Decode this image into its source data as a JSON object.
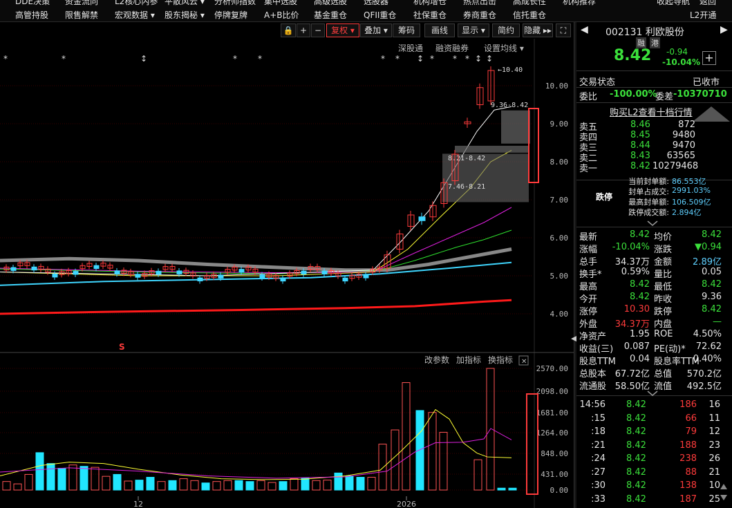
{
  "menu": {
    "row1": [
      {
        "label": "DDE决策",
        "x": 22
      },
      {
        "label": "资金流向",
        "x": 94
      },
      {
        "label": "L2核心内参",
        "x": 166
      },
      {
        "label": "平散风云 ▾",
        "x": 238
      },
      {
        "label": "分析师指数",
        "x": 310
      },
      {
        "label": "集中选股",
        "x": 382
      },
      {
        "label": "高级选股",
        "x": 454
      },
      {
        "label": "选股器",
        "x": 526
      },
      {
        "label": "机构增仓",
        "x": 598
      },
      {
        "label": "热点出击",
        "x": 670
      },
      {
        "label": "高成长性",
        "x": 742
      },
      {
        "label": "机构推荐",
        "x": 814
      }
    ],
    "row1_right": [
      "收起导航",
      "返回"
    ],
    "row2": [
      {
        "label": "高管持股"
      },
      {
        "label": "限售解禁"
      },
      {
        "label": "宏观数据 ▾"
      },
      {
        "label": "股东揭秘 ▾"
      },
      {
        "label": "停牌复牌"
      },
      {
        "label": "A+B比价"
      },
      {
        "label": "基金重仓"
      },
      {
        "label": "QFII重仓"
      },
      {
        "label": "社保重仓"
      },
      {
        "label": "券商重仓"
      },
      {
        "label": "信托重仓"
      }
    ],
    "row2_right": "L2开通"
  },
  "toolbar": {
    "lock": "🔒",
    "plus": "+",
    "minus": "−",
    "fuquan": "复权 ▾",
    "diejia": "叠加 ▾",
    "chouma": "筹码",
    "huaxian": "画线",
    "xianshi": "显示 ▾",
    "jianyue": "简约",
    "yincang": "隐藏 ▸▸",
    "fullscreen": "⛶"
  },
  "subbar": {
    "shengutong": "深股通",
    "rongzi": "融资融券",
    "junxian": "设置均线 ▾"
  },
  "vol_bar": {
    "gaicanshu": "改参数",
    "jiazhibiao": "加指标",
    "huanzhibiao": "换指标",
    "close": "✕"
  },
  "chart_data": [
    {
      "type": "candlestick",
      "title": "",
      "ylim": [
        3.5,
        10.6
      ],
      "yticks": [
        "10.00",
        "9.00",
        "8.00",
        "7.00",
        "6.00",
        "5.00",
        "4.00"
      ],
      "annotations": [
        "10.40",
        "9.36-8.42",
        "8.21-8.42",
        "7.46-8.21"
      ],
      "markers": [
        "*",
        "*",
        "↕",
        "*",
        "*",
        "*",
        "*",
        "↕",
        "*",
        "*",
        "*",
        "↕",
        "↕"
      ],
      "symbol": "S"
    },
    {
      "type": "bar",
      "title": "",
      "ylim": [
        0,
        2700
      ],
      "yticks": [
        "2570.00",
        "2098.00",
        "1681.00",
        "1264.00",
        "848.00",
        "431.00",
        "0.00"
      ],
      "xticks": [
        "12",
        "2026"
      ]
    }
  ],
  "stock": {
    "code_name": "002131 利欧股份",
    "tag1": "融",
    "tag2": "港",
    "price": "8.42",
    "change": "-0.94",
    "pct": "-10.04%",
    "status_label": "交易状态",
    "status_val": "已收市",
    "weibi_label": "委比",
    "weibi_val": "-100.00%",
    "weicha_label": "委差",
    "weicha_val": "-10370710",
    "l2_link": "购买L2查看十档行情",
    "sells": [
      {
        "label": "卖五",
        "price": "8.46",
        "vol": "872"
      },
      {
        "label": "卖四",
        "price": "8.45",
        "vol": "9480"
      },
      {
        "label": "卖三",
        "price": "8.44",
        "vol": "9470"
      },
      {
        "label": "卖二",
        "price": "8.43",
        "vol": "63565"
      },
      {
        "label": "卖一",
        "price": "8.42",
        "vol": "10279468"
      }
    ],
    "limit": {
      "tag": "跌停",
      "rows": [
        {
          "label": "当前封单额:",
          "val": "86.553亿"
        },
        {
          "label": "封单占成交:",
          "val": "2991.03%"
        },
        {
          "label": "最高封单额:",
          "val": "106.509亿"
        },
        {
          "label": "跌停成交额:",
          "val": "2.894亿"
        }
      ]
    },
    "quote": [
      {
        "l1": "最新",
        "v1": "8.42",
        "c1": "green",
        "l2": "均价",
        "v2": "8.42",
        "c2": "green"
      },
      {
        "l1": "涨幅",
        "v1": "-10.04%",
        "c1": "green",
        "l2": "涨跌",
        "v2": "▼0.94",
        "c2": "green"
      },
      {
        "l1": "总手",
        "v1": "34.37万",
        "c1": "white",
        "l2": "金额",
        "v2": "2.89亿",
        "c2": "cyan"
      },
      {
        "l1": "换手*",
        "v1": "0.59%",
        "c1": "white",
        "l2": "量比",
        "v2": "0.05",
        "c2": "white"
      },
      {
        "l1": "最高",
        "v1": "8.42",
        "c1": "green",
        "l2": "最低",
        "v2": "8.42",
        "c2": "green"
      },
      {
        "l1": "今开",
        "v1": "8.42",
        "c1": "green",
        "l2": "昨收",
        "v2": "9.36",
        "c2": "white"
      },
      {
        "l1": "涨停",
        "v1": "10.30",
        "c1": "red",
        "l2": "跌停",
        "v2": "8.42",
        "c2": "green"
      },
      {
        "l1": "外盘",
        "v1": "34.37万",
        "c1": "red",
        "l2": "内盘",
        "v2": "—",
        "c2": "green"
      },
      {
        "l1": "净资产",
        "v1": "1.95",
        "c1": "white",
        "l2": "ROE",
        "v2": "4.50%",
        "c2": "white"
      },
      {
        "l1": "收益(三)",
        "v1": "0.087",
        "c1": "white",
        "l2": "PE(动)*",
        "v2": "72.62",
        "c2": "white"
      },
      {
        "l1": "股息TTM",
        "v1": "0.04",
        "c1": "white",
        "l2": "股息率TTM",
        "v2": "0.40%",
        "c2": "white"
      },
      {
        "l1": "总股本",
        "v1": "67.72亿",
        "c1": "white",
        "l2": "总值",
        "v2": "570.2亿",
        "c2": "white"
      },
      {
        "l1": "流通股",
        "v1": "58.50亿",
        "c1": "white",
        "l2": "流值",
        "v2": "492.5亿",
        "c2": "white"
      }
    ],
    "ticks": [
      {
        "t": "14:56",
        "p": "8.42",
        "v": "186",
        "n": "16"
      },
      {
        "t": ":15",
        "p": "8.42",
        "v": "66",
        "n": "11"
      },
      {
        "t": ":18",
        "p": "8.42",
        "v": "79",
        "n": "12"
      },
      {
        "t": ":21",
        "p": "8.42",
        "v": "188",
        "n": "23"
      },
      {
        "t": ":24",
        "p": "8.42",
        "v": "238",
        "n": "26"
      },
      {
        "t": ":27",
        "p": "8.42",
        "v": "88",
        "n": "21"
      },
      {
        "t": ":30",
        "p": "8.42",
        "v": "138",
        "n": "10"
      },
      {
        "t": ":33",
        "p": "8.42",
        "v": "187",
        "n": "25"
      }
    ]
  }
}
